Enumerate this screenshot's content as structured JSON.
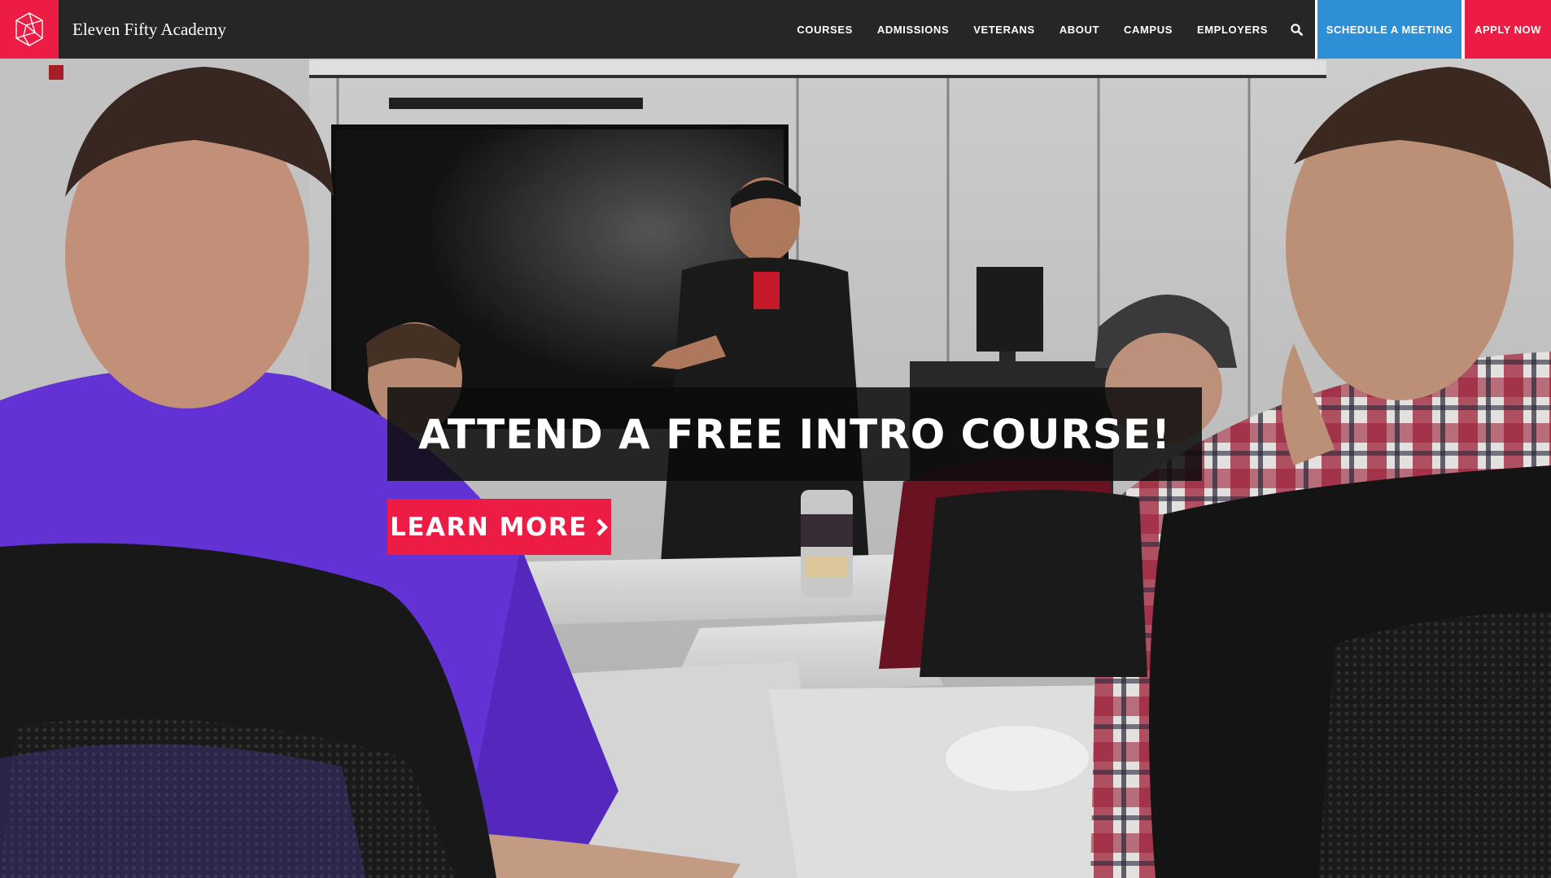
{
  "brand": {
    "name": "Eleven Fifty Academy",
    "logo_icon": "academy-geometric-logo-icon",
    "color": "#ec1c44"
  },
  "nav": {
    "items": [
      {
        "label": "COURSES"
      },
      {
        "label": "ADMISSIONS"
      },
      {
        "label": "VETERANS"
      },
      {
        "label": "ABOUT"
      },
      {
        "label": "CAMPUS"
      },
      {
        "label": "EMPLOYERS"
      }
    ],
    "search_icon": "search-icon",
    "schedule_label": "SCHEDULE A MEETING",
    "schedule_color": "#2d8fd5",
    "apply_label": "APPLY NOW",
    "apply_color": "#ec1c44"
  },
  "hero": {
    "headline": "ATTEND A FREE INTRO COURSE!",
    "cta_label": "LEARN MORE",
    "cta_icon": "chevron-right-icon",
    "background_image": "classroom-instructor-photo"
  }
}
